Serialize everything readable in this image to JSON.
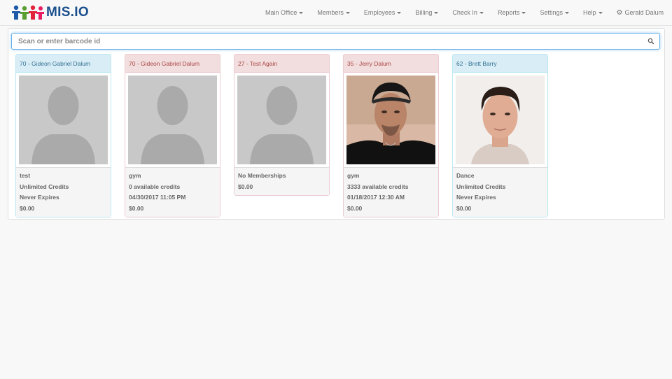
{
  "brand": {
    "name": "MIS.IO"
  },
  "nav": {
    "items": [
      {
        "label": "Main Office"
      },
      {
        "label": "Members"
      },
      {
        "label": "Employees"
      },
      {
        "label": "Billing"
      },
      {
        "label": "Check In"
      },
      {
        "label": "Reports"
      },
      {
        "label": "Settings"
      },
      {
        "label": "Help"
      }
    ],
    "user": "Gerald Dalum"
  },
  "search": {
    "placeholder": "Scan or enter barcode id",
    "value": ""
  },
  "colors": {
    "info_head": "#d9edf7",
    "danger_head": "#f2dede",
    "brand": "#1b4f8c"
  },
  "cards": [
    {
      "title": "70 - Gideon Gabriel Dalum",
      "status": "info",
      "photo": "placeholder",
      "lines": [
        "test",
        "Unlimited Credits",
        "Never Expires",
        "$0.00"
      ]
    },
    {
      "title": "70 - Gideon Gabriel Dalum",
      "status": "danger",
      "photo": "placeholder",
      "lines": [
        "gym",
        "0 available credits",
        "04/30/2017 11:05 PM",
        "$0.00"
      ]
    },
    {
      "title": "27 - Test Again",
      "status": "danger",
      "photo": "placeholder",
      "lines": [
        "No Memberships",
        "$0.00"
      ]
    },
    {
      "title": "35 - Jerry Dalum",
      "status": "danger",
      "photo": "man-backwards-cap",
      "lines": [
        "gym",
        "3333 available credits",
        "01/18/2017 12:30 AM",
        "$0.00"
      ]
    },
    {
      "title": "62 - Brett Barry",
      "status": "info",
      "photo": "man-portrait",
      "lines": [
        "Dance",
        "Unlimited Credits",
        "Never Expires",
        "$0.00"
      ]
    }
  ]
}
